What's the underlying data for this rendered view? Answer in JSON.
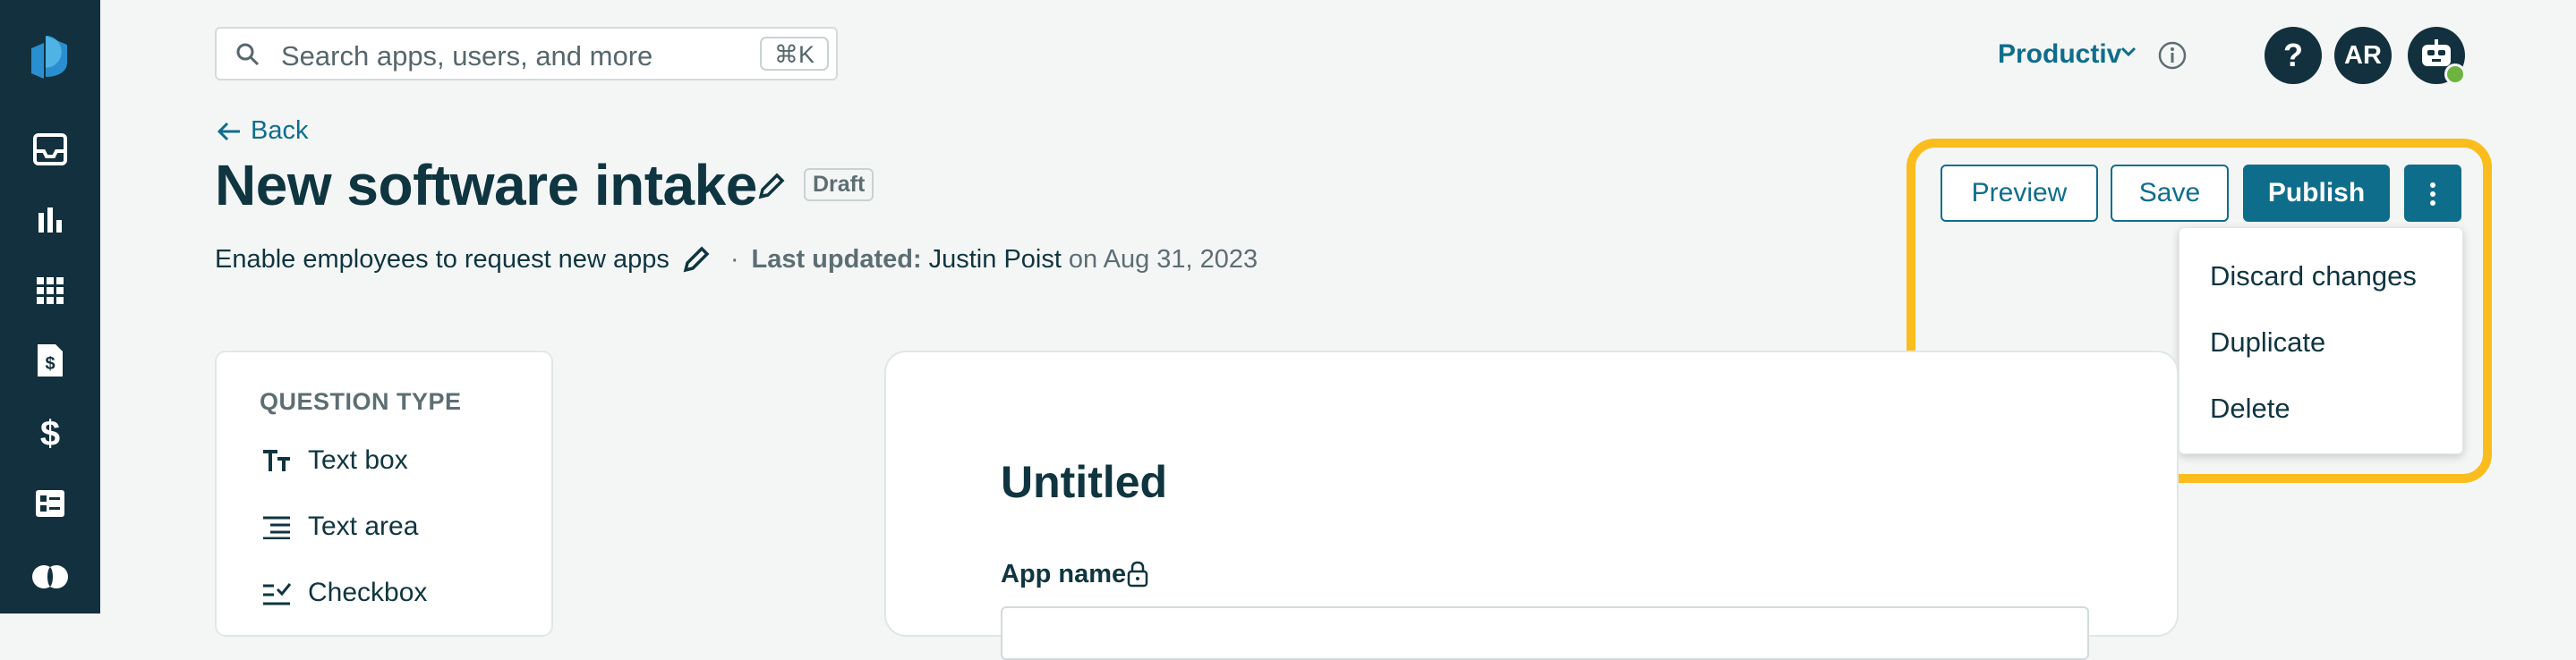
{
  "sidebar": {
    "items": [
      {
        "icon": "logo-icon"
      },
      {
        "icon": "inbox-icon"
      },
      {
        "icon": "analytics-icon"
      },
      {
        "icon": "apps-grid-icon"
      },
      {
        "icon": "contract-icon"
      },
      {
        "icon": "dollar-icon"
      },
      {
        "icon": "forms-icon"
      },
      {
        "icon": "integrations-icon"
      }
    ]
  },
  "header": {
    "search_placeholder": "Search apps, users, and more",
    "search_shortcut": "⌘K",
    "org_name": "Productiv",
    "help_label": "?",
    "avatar_initials": "AR"
  },
  "page": {
    "back_label": "Back",
    "title": "New software intake",
    "status_badge": "Draft",
    "description": "Enable employees to request new apps",
    "separator": "·",
    "last_updated_label": "Last updated:",
    "last_updated_by": "Justin Poist",
    "last_updated_on": "on Aug 31, 2023"
  },
  "actions": {
    "preview": "Preview",
    "save": "Save",
    "publish": "Publish",
    "more_menu": [
      "Discard changes",
      "Duplicate",
      "Delete"
    ]
  },
  "question_panel": {
    "heading": "QUESTION TYPE",
    "items": [
      {
        "label": "Text box",
        "icon": "text-box-icon"
      },
      {
        "label": "Text area",
        "icon": "text-area-icon"
      },
      {
        "label": "Checkbox",
        "icon": "checkbox-list-icon"
      }
    ]
  },
  "form": {
    "title": "Untitled",
    "fields": [
      {
        "label": "App name",
        "locked": true
      }
    ]
  },
  "colors": {
    "sidebar": "#12303d",
    "accent": "#0f6d8c",
    "highlight": "#fbbd1e",
    "online": "#6cb33f"
  }
}
